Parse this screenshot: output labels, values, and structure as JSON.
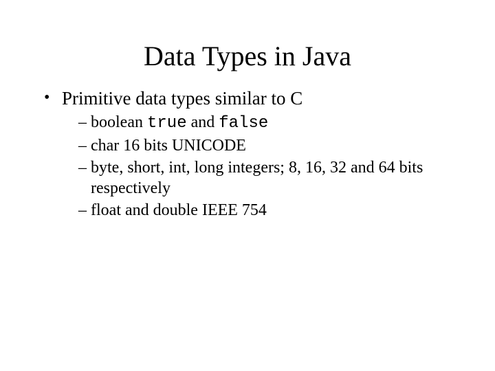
{
  "title": "Data Types in Java",
  "bullet1": "Primitive data types similar to C",
  "sub1_pre": "boolean ",
  "sub1_code1": "true",
  "sub1_mid": " and ",
  "sub1_code2": "false",
  "sub2": "char 16 bits UNICODE",
  "sub3": "byte, short, int, long integers; 8, 16, 32 and 64 bits respectively",
  "sub4": "float and double IEEE 754"
}
